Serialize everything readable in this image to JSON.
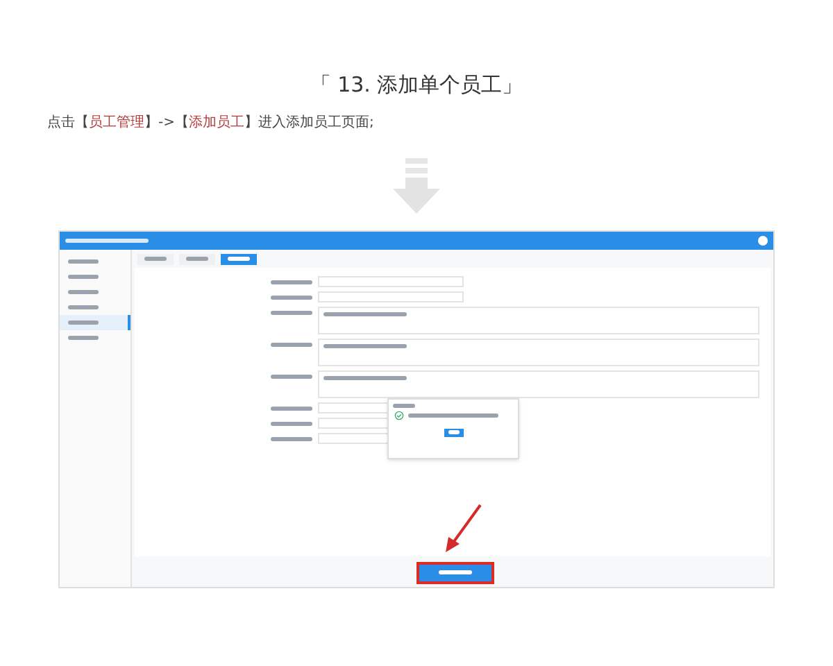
{
  "heading": "「 13. 添加单个员工」",
  "instruction": [
    {
      "text": "点击【",
      "highlight": false
    },
    {
      "text": "员工管理",
      "highlight": true
    },
    {
      "text": "】->【",
      "highlight": false
    },
    {
      "text": "添加员工",
      "highlight": true
    },
    {
      "text": "】进入添加员工页面;",
      "highlight": false
    }
  ],
  "app": {
    "sidebar_items": [
      {
        "selected": false
      },
      {
        "selected": false
      },
      {
        "selected": false
      },
      {
        "selected": false
      },
      {
        "selected": true
      },
      {
        "selected": false
      }
    ],
    "tabs": [
      {
        "selected": false
      },
      {
        "selected": false
      },
      {
        "selected": true
      }
    ],
    "fields": [
      {
        "kind": "input"
      },
      {
        "kind": "input"
      },
      {
        "kind": "area"
      },
      {
        "kind": "area"
      },
      {
        "kind": "area"
      },
      {
        "kind": "input"
      },
      {
        "kind": "input"
      },
      {
        "kind": "input"
      }
    ]
  }
}
